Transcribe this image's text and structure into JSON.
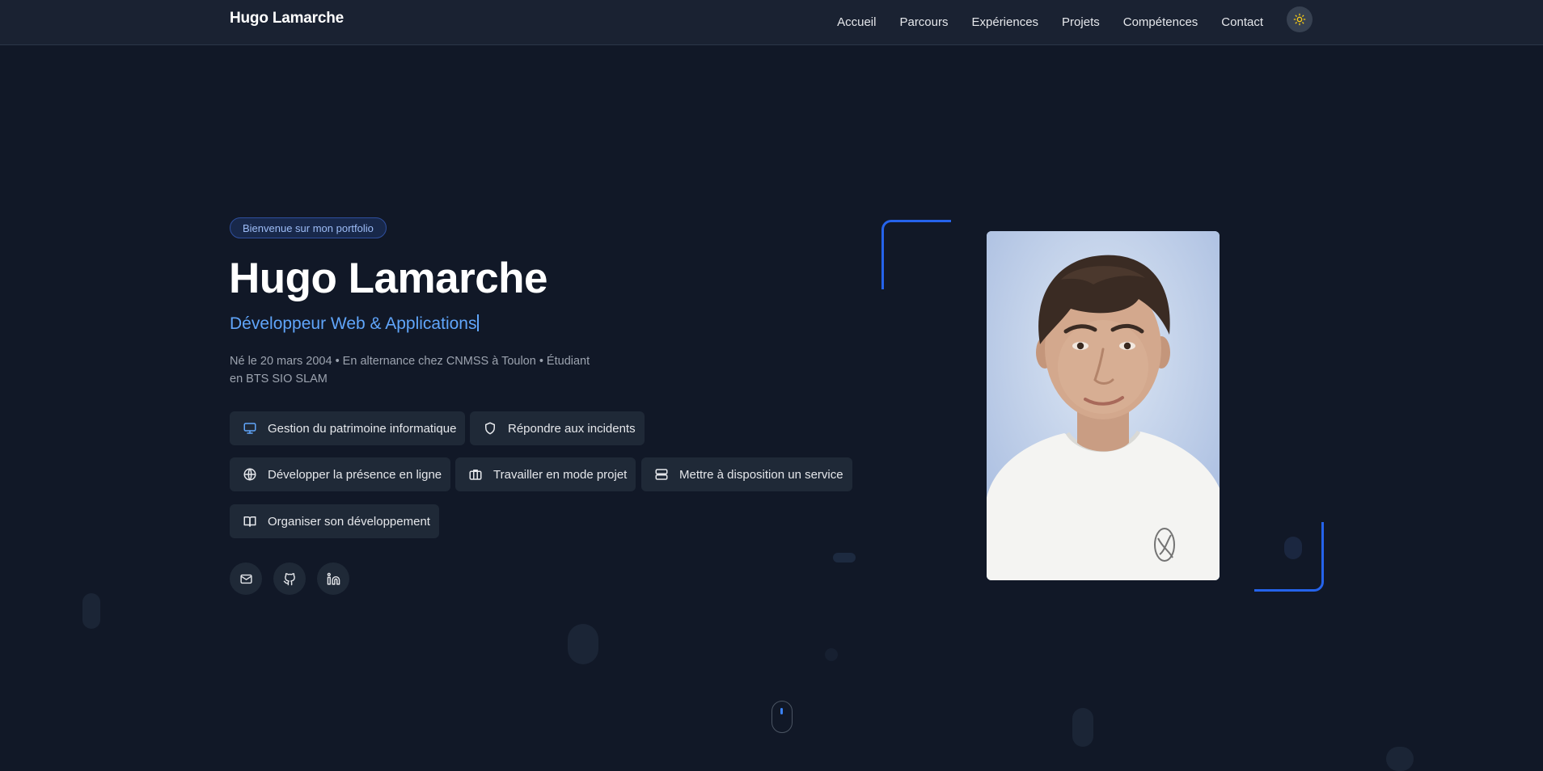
{
  "header": {
    "brand": "Hugo Lamarche",
    "nav": [
      "Accueil",
      "Parcours",
      "Expériences",
      "Projets",
      "Compétences",
      "Contact"
    ],
    "theme_toggle_icon": "sun-icon"
  },
  "hero": {
    "badge": "Bienvenue sur mon portfolio",
    "name": "Hugo Lamarche",
    "role": "Développeur Web & Applications",
    "description_line1": "Né le 20 mars 2004 • En alternance chez CNMSS à Toulon • Étudiant",
    "description_line2": "en BTS SIO SLAM",
    "skills": [
      {
        "label": "Gestion du patrimoine informatique",
        "icon": "monitor-icon"
      },
      {
        "label": "Répondre aux incidents",
        "icon": "shield-icon"
      },
      {
        "label": "Développer la présence en ligne",
        "icon": "globe-icon"
      },
      {
        "label": "Travailler en mode projet",
        "icon": "briefcase-icon"
      },
      {
        "label": "Mettre à disposition un service",
        "icon": "server-icon"
      },
      {
        "label": "Organiser son développement",
        "icon": "book-icon"
      }
    ],
    "socials": [
      "mail-icon",
      "github-icon",
      "linkedin-icon"
    ]
  },
  "colors": {
    "background": "#111827",
    "header": "#1a2232",
    "accent": "#3b82f6",
    "role_text": "#60a5fa",
    "chip_bg": "#1f2937"
  }
}
